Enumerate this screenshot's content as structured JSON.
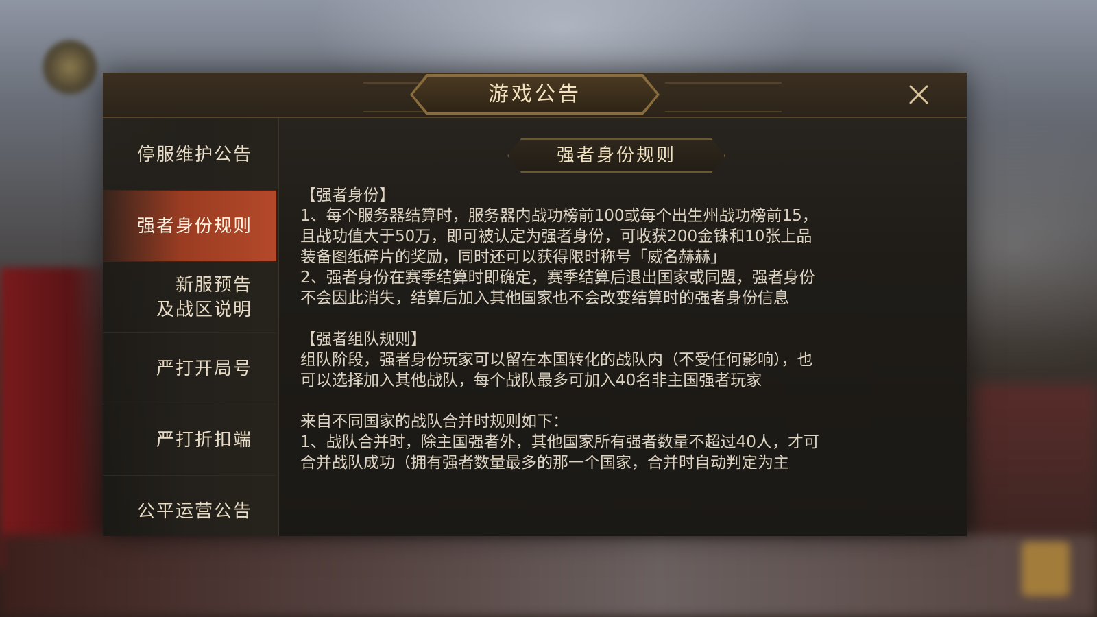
{
  "window": {
    "title": "游戏公告"
  },
  "sidebar": {
    "items": [
      {
        "label": "停服维护公告",
        "active": false
      },
      {
        "label": "强者身份规则",
        "active": true
      },
      {
        "label": "新服预告",
        "label_line2": "及战区说明",
        "active": false
      },
      {
        "label": "严打开局号",
        "active": false
      },
      {
        "label": "严打折扣端",
        "active": false
      },
      {
        "label": "公平运营公告",
        "active": false
      }
    ]
  },
  "article": {
    "title": "强者身份规则",
    "lines": [
      "【强者身份】",
      "1、每个服务器结算时，服务器内战功榜前100或每个出生州战功榜前15，",
      "且战功值大于50万，即可被认定为强者身份，可收获200金铢和10张上品",
      "装备图纸碎片的奖励，同时还可以获得限时称号「威名赫赫」",
      "2、强者身份在赛季结算时即确定，赛季结算后退出国家或同盟，强者身份",
      "不会因此消失，结算后加入其他国家也不会改变结算时的强者身份信息",
      "",
      "【强者组队规则】",
      "组队阶段，强者身份玩家可以留在本国转化的战队内（不受任何影响），也",
      "可以选择加入其他战队，每个战队最多可加入40名非主国强者玩家",
      "",
      "来自不同国家的战队合并时规则如下：",
      "1、战队合并时，除主国强者外，其他国家所有强者数量不超过40人，才可",
      "合并战队成功（拥有强者数量最多的那一个国家，合并时自动判定为主"
    ]
  },
  "colors": {
    "active_tab": "#b4492a",
    "panel_bg": "#1f1c18",
    "title_gold": "#f3e2bd"
  },
  "icons": {
    "close": "close-icon"
  }
}
